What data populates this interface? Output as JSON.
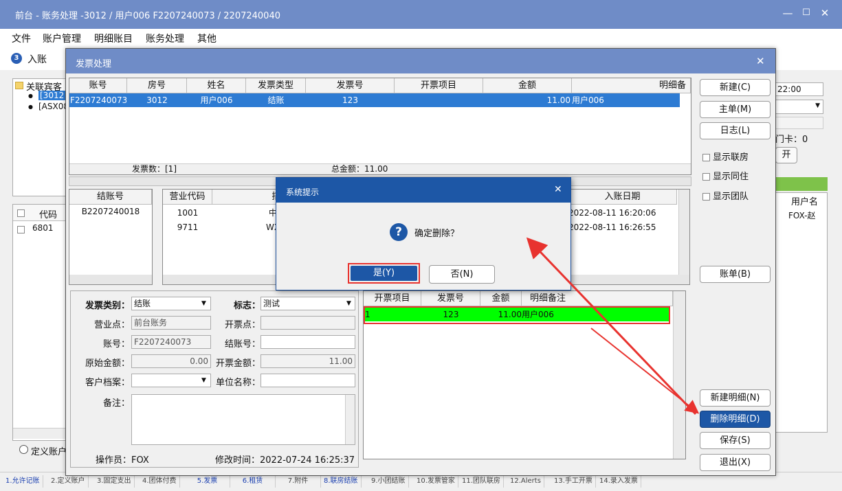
{
  "window": {
    "title": "前台 - 账务处理 -3012 / 用户006 F2207240073 / 2207240040",
    "min": "—",
    "max": "☐",
    "close": "✕"
  },
  "menu": [
    "文件",
    "账户管理",
    "明细账目",
    "账务处理",
    "其他"
  ],
  "toolbar": {
    "entry_label": "入账",
    "entry_icon": "3"
  },
  "bg": {
    "tree_root": "关联宾客",
    "tree_items": [
      "[3012",
      "[ASX08"
    ],
    "col_code": "代码",
    "row_code": "6801",
    "time": "22:00",
    "card": "门卡：0",
    "open_btn": "开",
    "user_col": "用户名",
    "user_val": "FOX-赵",
    "define_acc": "定义账户"
  },
  "invoice_dialog": {
    "title": "发票处理",
    "close": "✕",
    "columns": [
      "账号",
      "房号",
      "姓名",
      "发票类型",
      "发票号",
      "开票项目",
      "金额",
      "明细备"
    ],
    "row": {
      "account": "F2207240073",
      "room": "3012",
      "name": "用户006",
      "type": "结账",
      "number": "123",
      "item": "",
      "amount": "11.00",
      "note": "用户006"
    },
    "count_label": "发票数：[1]",
    "total_label": "总金额：11.00",
    "settle_col": "结账号",
    "settle_val": "B2207240018",
    "biz_cols": [
      "营业代码",
      "描述"
    ],
    "biz_rows": [
      {
        "code": "1001",
        "desc": "中餐厅"
      },
      {
        "code": "9711",
        "desc": "WX支付"
      }
    ],
    "date_col": "入账日期",
    "dates": [
      "2022-08-11 16:20:06",
      "2022-08-11 16:26:55"
    ],
    "form": {
      "cat_label": "发票类别：",
      "cat_val": "结账",
      "flag_label": "标志：",
      "flag_val": "测试",
      "point_label": "营业点：",
      "point_val": "前台账务",
      "inv_point_label": "开票点：",
      "inv_point_val": "",
      "acc_label": "账号：",
      "acc_val": "F2207240073",
      "settle_label": "结账号：",
      "settle_val": "",
      "orig_label": "原始金额：",
      "orig_val": "0.00",
      "inv_amt_label": "开票金额：",
      "inv_amt_val": "11.00",
      "cust_label": "客户档案：",
      "cust_val": "",
      "unit_label": "单位名称：",
      "unit_val": "",
      "remark_label": "备注：",
      "operator": "操作员：FOX",
      "modified": "修改时间：2022-07-24 16:25:37"
    },
    "detail_cols": [
      "开票项目",
      "发票号",
      "金额",
      "明细备注"
    ],
    "detail_row": {
      "item": "1",
      "number": "123",
      "amount": "11.00",
      "note": "用户006"
    },
    "buttons": {
      "new": "新建(C)",
      "master": "主单(M)",
      "log": "日志(L)",
      "bill": "账单(B)",
      "new_detail": "新建明细(N)",
      "del_detail": "删除明细(D)",
      "save": "保存(S)",
      "exit": "退出(X)"
    },
    "checks": [
      "显示联房",
      "显示同住",
      "显示团队"
    ]
  },
  "confirm": {
    "title": "系统提示",
    "close": "✕",
    "icon": "?",
    "message": "确定删除？",
    "yes": "是(Y)",
    "no": "否(N)"
  },
  "tabs": [
    "1.允许记账",
    "2.定义账户",
    "3.固定支出",
    "4.团体付费",
    "5.发票",
    "6.租赁",
    "7.附件",
    "8.联房结账",
    "9.小团结账",
    "10.发票管家",
    "11.团队联房",
    "12.Alerts",
    "13.手工开票",
    "14.录入发票"
  ],
  "colors": {
    "accent": "#6f8cc7",
    "selection": "#2d7bd3",
    "highlight": "#00ff00",
    "annotation": "#e8332f",
    "primary_btn": "#1d57a6"
  }
}
